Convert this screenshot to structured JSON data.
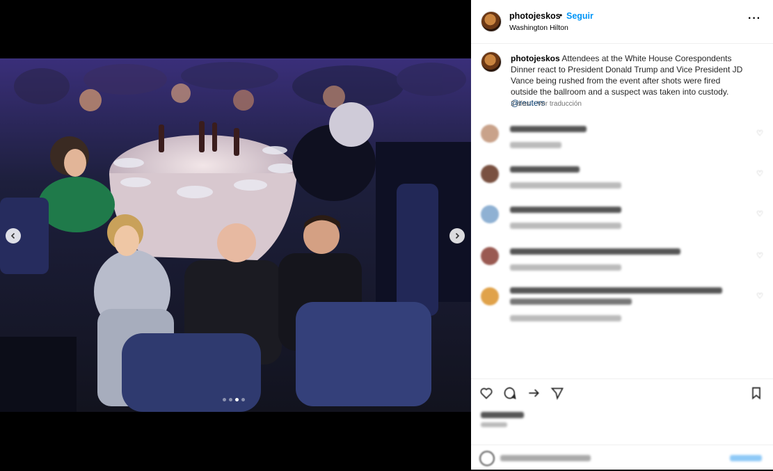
{
  "post": {
    "username": "photojeskos",
    "separator": "•",
    "follow_label": "Seguir",
    "location": "Washington Hilton",
    "more_label": "···"
  },
  "caption": {
    "username": "photojeskos",
    "text": " Attendees at the White House Corespondents Dinner react to President Donald Trump and Vice President JD Vance being rushed from the event after shots were fired outside the ballroom and a suspect was taken into custody. ",
    "mention": "@reuters",
    "time": "2 días",
    "translate_label": "Ver traducción"
  },
  "carousel": {
    "slide_count": 4,
    "active_slide": 3,
    "prev_icon": "chevron-left-icon",
    "next_icon": "chevron-right-icon"
  },
  "colors": {
    "follow_blue": "#0095f6",
    "mention_blue": "#00376b",
    "meta_gray": "#737373"
  },
  "icons": [
    "heart-icon",
    "comment-icon",
    "share-icon",
    "send-icon",
    "bookmark-icon",
    "emoji-icon"
  ]
}
